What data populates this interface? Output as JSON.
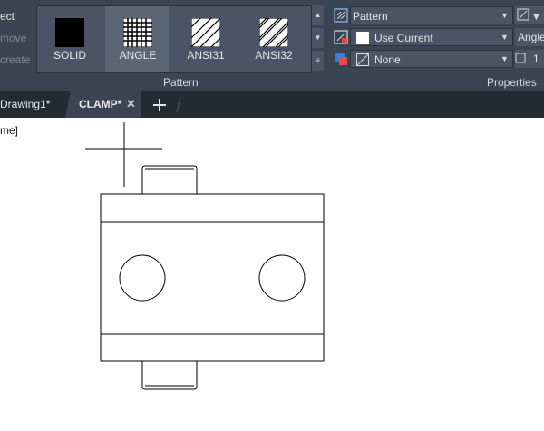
{
  "ribbon": {
    "left_items": [
      "ect",
      "move",
      "create"
    ],
    "pattern": {
      "title": "Pattern",
      "swatches": [
        {
          "label": "SOLID",
          "icon": "solid-fill-icon"
        },
        {
          "label": "ANGLE",
          "icon": "angle-grid-icon",
          "selected": true
        },
        {
          "label": "ANSI31",
          "icon": "ansi31-hatch-icon"
        },
        {
          "label": "ANSI32",
          "icon": "ansi32-hatch-icon"
        }
      ]
    },
    "properties": {
      "title": "Properties",
      "rows": [
        {
          "value": "Pattern",
          "icon": "hatch-type-icon"
        },
        {
          "value": "Use Current",
          "icon": "hatch-color-icon"
        },
        {
          "value": "None",
          "icon": "background-color-icon"
        }
      ],
      "side": [
        "",
        "Angle",
        "1"
      ]
    }
  },
  "tabs": [
    {
      "label": "Drawing1*",
      "active": false
    },
    {
      "label": "CLAMP*",
      "active": true
    }
  ],
  "canvas": {
    "command_text": "me]"
  },
  "colors": {
    "ribbon_bg": "#3b4453",
    "tabbar_bg": "#242a33",
    "accent_selected": "#5a6576",
    "canvas_bg": "#ffffff"
  }
}
